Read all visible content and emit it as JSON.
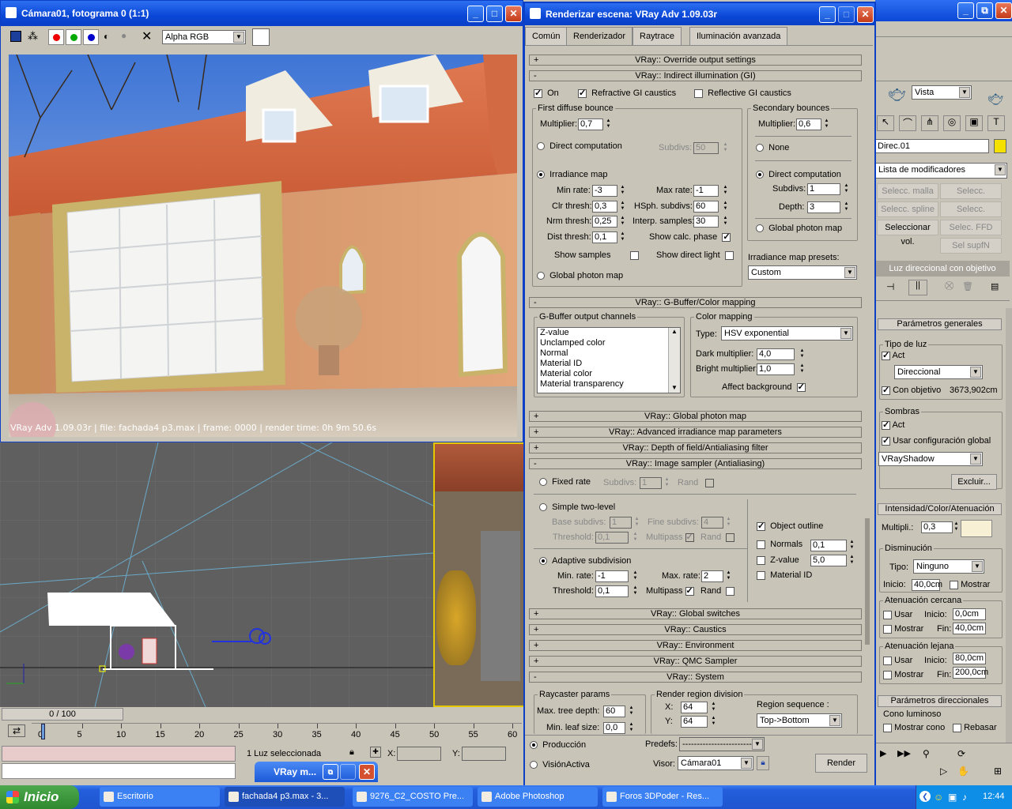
{
  "frame_window": {
    "title": "Cámara01, fotograma 0 (1:1)",
    "channel": "Alpha RGB",
    "status": "VRay Adv 1.09.03r | file: fachada4 p3.max | frame: 0000 | render time: 0h 9m 50.6s"
  },
  "render_dialog": {
    "title": "Renderizar escena: VRay Adv 1.09.03r",
    "tabs": [
      "Común",
      "Renderizador",
      "Raytrace",
      "Iluminación avanzada"
    ],
    "rollouts": {
      "override": "VRay:: Override output settings",
      "gi": "VRay:: Indirect illumination (GI)",
      "gbuffer": "VRay:: G-Buffer/Color mapping",
      "photon": "VRay:: Global photon map",
      "adv_irr": "VRay:: Advanced irradiance map parameters",
      "dof": "VRay:: Depth of field/Antialiasing filter",
      "sampler": "VRay:: Image sampler (Antialiasing)",
      "switches": "VRay:: Global switches",
      "caustics": "VRay:: Caustics",
      "environment": "VRay:: Environment",
      "qmc": "VRay:: QMC Sampler",
      "system": "VRay:: System"
    },
    "gi": {
      "on": "On",
      "refr": "Refractive GI caustics",
      "refl": "Reflective GI caustics",
      "first": "First diffuse bounce",
      "multiplier": "Multiplier:",
      "mult1": "0,7",
      "direct": "Direct computation",
      "subdivs": "Subdivs:",
      "subdivs_val": "50",
      "irr": "Irradiance map",
      "minrate": "Min rate:",
      "minrate_v": "-3",
      "maxrate": "Max rate:",
      "maxrate_v": "-1",
      "clr": "Clr thresh:",
      "clr_v": "0,3",
      "hsph": "HSph. subdivs:",
      "hsph_v": "60",
      "nrm": "Nrm thresh:",
      "nrm_v": "0,25",
      "interp": "Interp. samples:",
      "interp_v": "30",
      "dist": "Dist thresh:",
      "dist_v": "0,1",
      "showcalc": "Show calc. phase",
      "showsamples": "Show samples",
      "showdirect": "Show direct light",
      "gpm": "Global photon map",
      "second": "Secondary bounces",
      "mult2": "0,6",
      "none": "None",
      "direct2": "Direct computation",
      "subdivs2_lbl": "Subdivs:",
      "subdivs2": "1",
      "depth_lbl": "Depth:",
      "depth": "3",
      "gpm2": "Global photon map",
      "presets_lbl": "Irradiance map presets:",
      "presets": "Custom"
    },
    "gb": {
      "channels_lbl": "G-Buffer output channels",
      "channels": [
        "Z-value",
        "Unclamped color",
        "Normal",
        "Material ID",
        "Material color",
        "Material transparency"
      ],
      "cm_lbl": "Color mapping",
      "type_lbl": "Type:",
      "type": "HSV exponential",
      "dark_lbl": "Dark multiplier:",
      "dark": "4,0",
      "bright_lbl": "Bright multiplier:",
      "bright": "1,0",
      "affect": "Affect background"
    },
    "samp": {
      "fixed": "Fixed rate",
      "subdivs_lbl": "Subdivs:",
      "subdivs": "1",
      "rand": "Rand",
      "simple": "Simple two-level",
      "base_lbl": "Base subdivs:",
      "base": "1",
      "fine_lbl": "Fine subdivs:",
      "fine": "4",
      "thr_lbl": "Threshold:",
      "thr": "0,1",
      "multipass": "Multipass",
      "adaptive": "Adaptive subdivision",
      "min_lbl": "Min. rate:",
      "min": "-1",
      "max_lbl": "Max. rate:",
      "max": "2",
      "thr2": "0,1",
      "outline": "Object outline",
      "normals": "Normals",
      "normals_v": "0,1",
      "zvalue": "Z-value",
      "zvalue_v": "5,0",
      "matid": "Material ID"
    },
    "sys": {
      "raycaster": "Raycaster params",
      "maxtree_lbl": "Max. tree depth:",
      "maxtree": "60",
      "minleaf_lbl": "Min. leaf size:",
      "minleaf": "0,0",
      "region": "Render region division",
      "x_lbl": "X:",
      "x": "64",
      "y_lbl": "Y:",
      "y": "64",
      "seq_lbl": "Region sequence :",
      "seq": "Top->Bottom"
    },
    "bottom": {
      "prod": "Producción",
      "active": "VisiónActiva",
      "predefs": "Predefs:",
      "predefs_val": "------------------------",
      "visor": "Visor:",
      "visor_val": "Cámara01",
      "render": "Render"
    }
  },
  "right_panel": {
    "vista": "Vista",
    "objname": "Direc.01",
    "modlist": "Lista de modificadores",
    "sel_btns": [
      "Selecc. malla",
      "Selecc. corrector",
      "Selecc. spline",
      "Selecc. poligonal",
      "Seleccionar vol.",
      "Selec. FFD",
      "",
      "Sel supfN"
    ],
    "lighttype": "Luz direccional con objetivo",
    "params": "Parámetros generales",
    "tipo": "Tipo de luz",
    "act": "Act",
    "dir": "Direccional",
    "conobj": "Con objetivo",
    "conobj_v": "3673,902cm",
    "sombras": "Sombras",
    "act2": "Act",
    "usarcfg": "Usar configuración global",
    "shadow": "VRayShadow",
    "excluir": "Excluir...",
    "intens": "Intensidad/Color/Atenuación",
    "multi_lbl": "Multipli.:",
    "multi": "0,3",
    "dismin": "Disminución",
    "tipo2": "Tipo:",
    "tipo2_v": "Ninguno",
    "inicio": "Inicio:",
    "inicio_v": "40,0cm",
    "mostrar": "Mostrar",
    "aten_c": "Atenuación cercana",
    "usar": "Usar",
    "inicio2": "Inicio:",
    "inicio2_v": "0,0cm",
    "fin": "Fin:",
    "fin_v": "40,0cm",
    "aten_l": "Atenuación lejana",
    "inicio3_v": "80,0cm",
    "fin2_v": "200,0cm",
    "pdir": "Parámetros direccionales",
    "cono": "Cono luminoso",
    "mcono": "Mostrar cono",
    "rebasar": "Rebasar",
    "colors": {
      "objcolor": "#f5e100",
      "lightcolor": "#f7f0d4"
    }
  },
  "viewport": {
    "frame": "0 / 100",
    "ticks": [
      "0",
      "5",
      "10",
      "15",
      "20",
      "25",
      "30",
      "35",
      "40",
      "45",
      "50",
      "55",
      "60"
    ],
    "status": "1 Luz seleccionada",
    "x_lbl": "X:",
    "y_lbl": "Y:",
    "mini": "VRay m..."
  },
  "taskbar": {
    "start": "Inicio",
    "items": [
      "Escritorio",
      "fachada4 p3.max - 3...",
      "9276_C2_COSTO Pre...",
      "Adobe Photoshop",
      "Foros 3DPoder - Res..."
    ],
    "clock": "12:44"
  }
}
